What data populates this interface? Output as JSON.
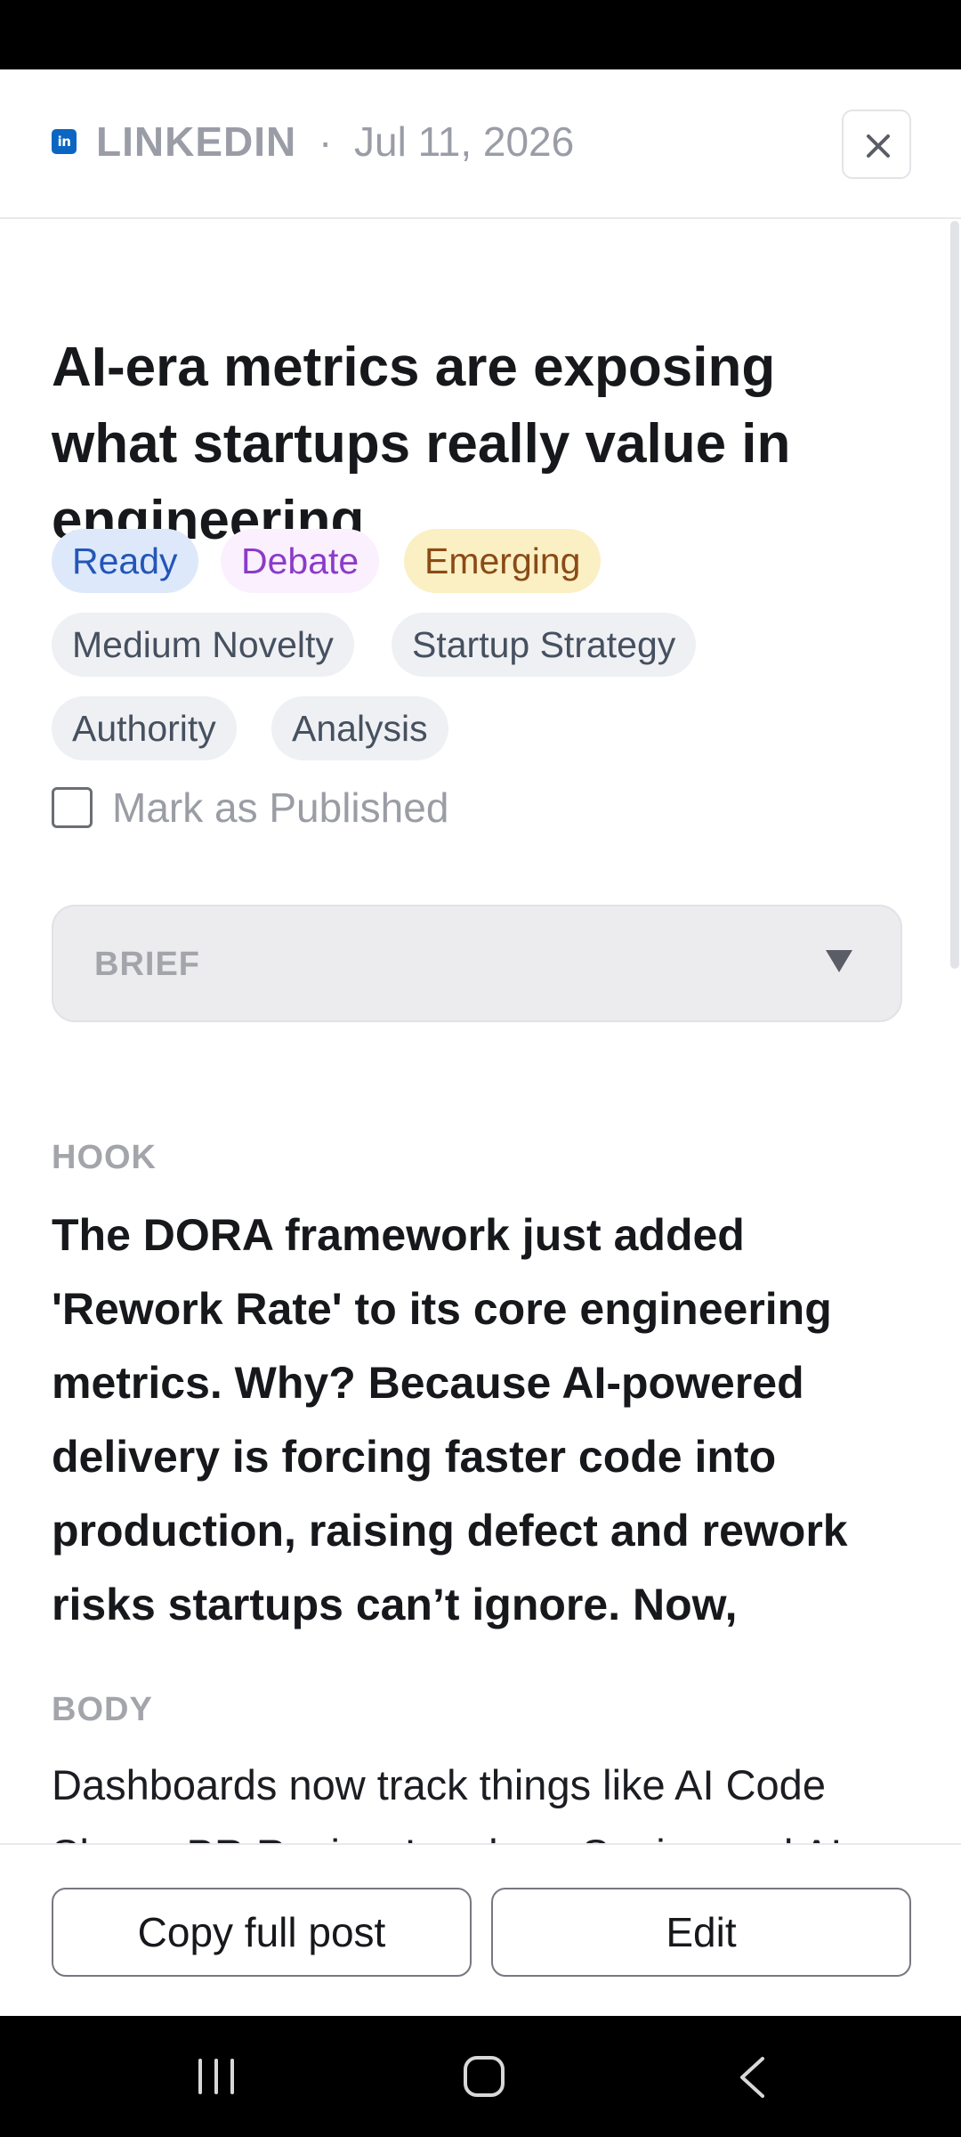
{
  "header": {
    "platform_icon_text": "in",
    "platform": "LINKEDIN",
    "separator": "·",
    "date": "Jul 11, 2026",
    "close_icon": "close-icon"
  },
  "post": {
    "title": "AI-era metrics are exposing what startups really value in engineering",
    "tags": [
      "Ready",
      "Debate",
      "Emerging",
      "Medium Novelty",
      "Startup Strategy",
      "Authority",
      "Analysis"
    ],
    "mark_published_label": "Mark as Published",
    "mark_published_checked": false
  },
  "brief": {
    "label": "BRIEF",
    "arrow_icon": "caret-down-icon"
  },
  "hook": {
    "label": "HOOK",
    "text": "The DORA framework just added 'Rework Rate' to its core engineering metrics. Why? Because AI-powered delivery is forcing faster code into production, raising defect and rework risks startups can’t ignore. Now,"
  },
  "body": {
    "label": "BODY",
    "text": "Dashboards now track things like AI Code Share, PR Review Load per Senior, and AI Suggestion Acceptance Rate. The"
  },
  "footer": {
    "copy_label": "Copy full post",
    "edit_label": "Edit"
  },
  "colors": {
    "linkedin_blue": "#0a66c2",
    "ready_bg": "#dde9fb",
    "ready_text": "#2456b8",
    "debate_bg": "#fbf0fd",
    "debate_text": "#8b3bc8",
    "emerging_bg": "#fbefc4",
    "emerging_text": "#8a4b15"
  },
  "system_nav": [
    "recents-icon",
    "home-icon",
    "back-icon"
  ]
}
